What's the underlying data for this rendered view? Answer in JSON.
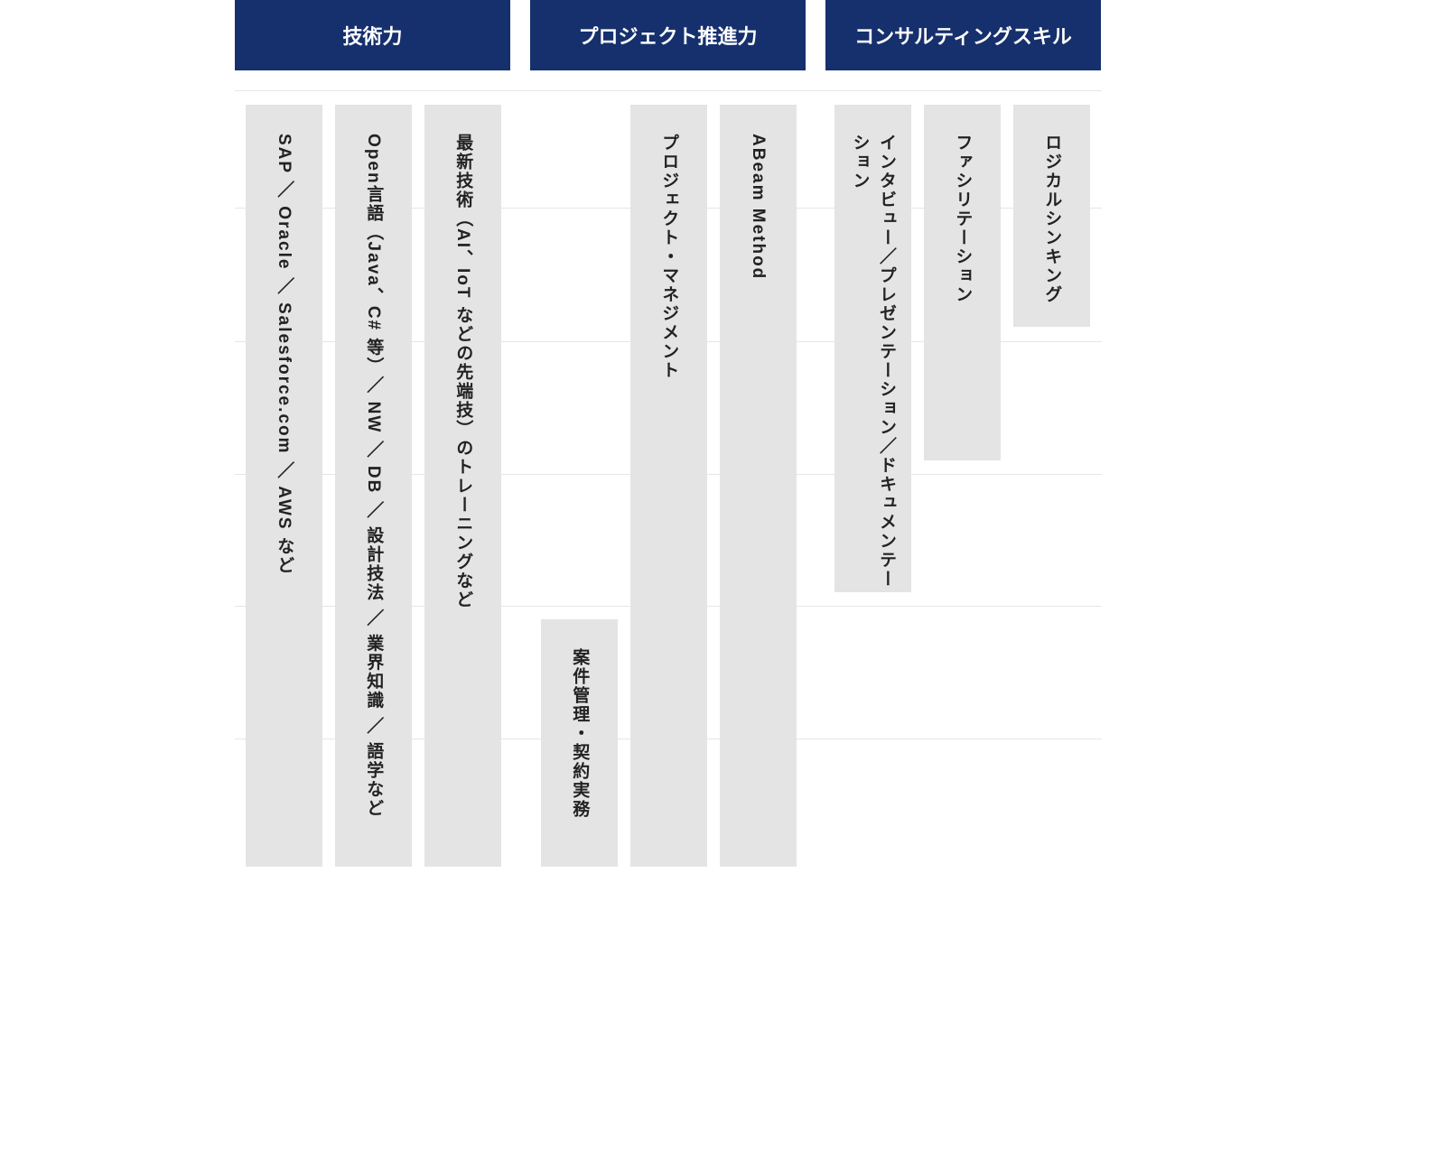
{
  "headers": {
    "col1": "技術力",
    "col2": "プロジェクト推進力",
    "col3": "コンサルティングスキル"
  },
  "pillars": {
    "g1": {
      "p1": "SAP ／ Oracle ／ Salesforce.com ／ AWS など",
      "p2": "Open言語（Java、C# 等）／ NW ／ DB ／ 設計技法 ／ 業界知識 ／ 語学など",
      "p3": "最新技術（AI、IoT などの先端技）のトレーニングなど"
    },
    "g2": {
      "p1": "案件管理・契約実務",
      "p2": "プロジェクト・マネジメント",
      "p3": "ABeam Method"
    },
    "g3": {
      "p1": "インタビュー／プレゼンテーション／ドキュメンテーション",
      "p2": "ファシリテーション",
      "p3": "ロジカルシンキング"
    }
  }
}
